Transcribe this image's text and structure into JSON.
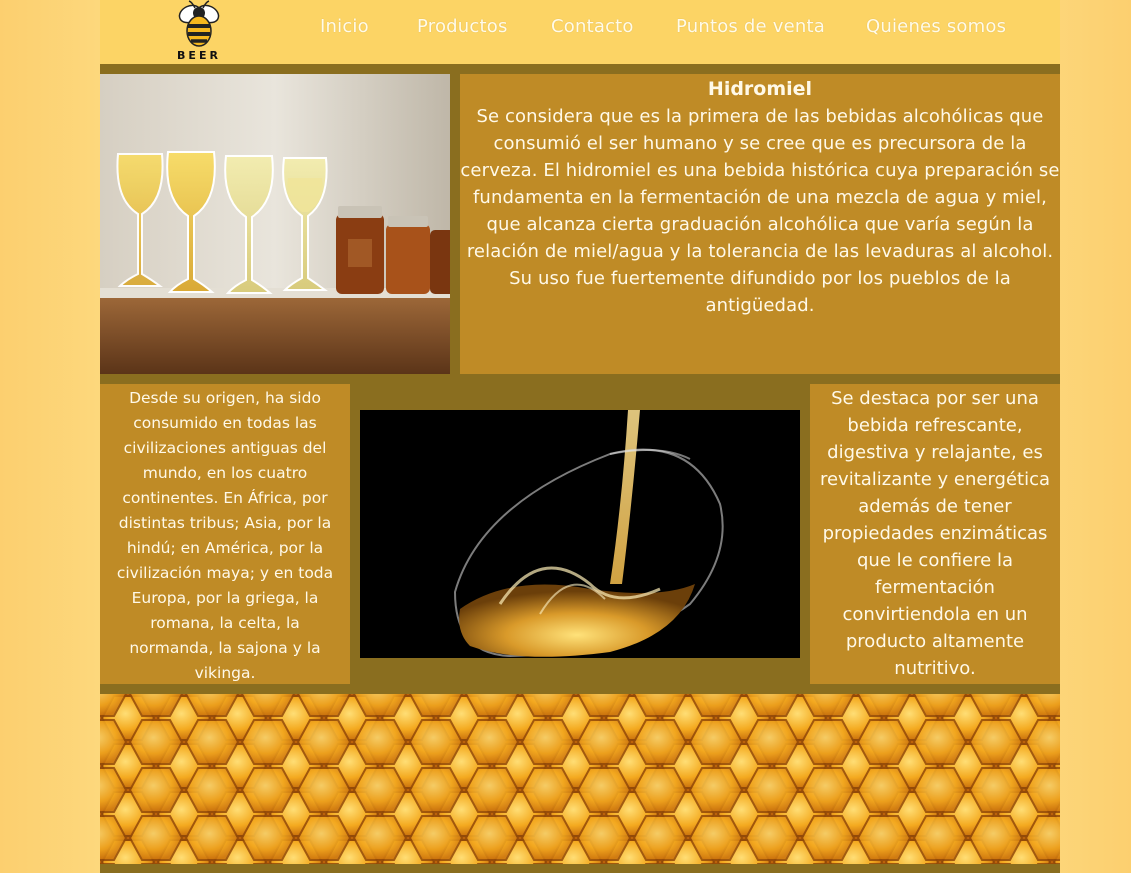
{
  "logo": {
    "text": "BEER",
    "icon": "bee-icon"
  },
  "nav": {
    "items": [
      {
        "label": "Inicio"
      },
      {
        "label": "Productos"
      },
      {
        "label": "Contacto"
      },
      {
        "label": "Puntos de venta"
      },
      {
        "label": "Quienes somos"
      }
    ]
  },
  "intro": {
    "title": "Hidromiel",
    "body": "Se considera que es la primera de las bebidas alcohólicas que consumió el ser humano y se cree que es precursora de la cerveza. El hidromiel es una bebida histórica cuya preparación se fundamenta en la fermentación de una mezcla de agua y miel, que alcanza cierta graduación alcohólica que varía según la relación de miel/agua y la tolerancia de las levaduras al alcohol. Su uso fue fuertemente difundido por los pueblos de la antigüedad."
  },
  "history": {
    "body": "Desde su origen, ha sido consumido en todas las civilizaciones antiguas del mundo, en los cuatro continentes. En África, por distintas tribus; Asia, por la hindú; en América, por la civilización maya; y en toda Europa, por la griega, la romana, la celta, la normanda, la sajona y la vikinga."
  },
  "benefits": {
    "body": "Se destaca por ser una bebida refrescante, digestiva y relajante, es revitalizante y energética además de tener propiedades enzimáticas que le confiere la fermentación convirtiendola en un producto altamente nutritivo."
  },
  "colors": {
    "header": "#fcd465",
    "panel": "#bf8b26",
    "band": "#8a6e1f",
    "text": "#fff9e8"
  }
}
